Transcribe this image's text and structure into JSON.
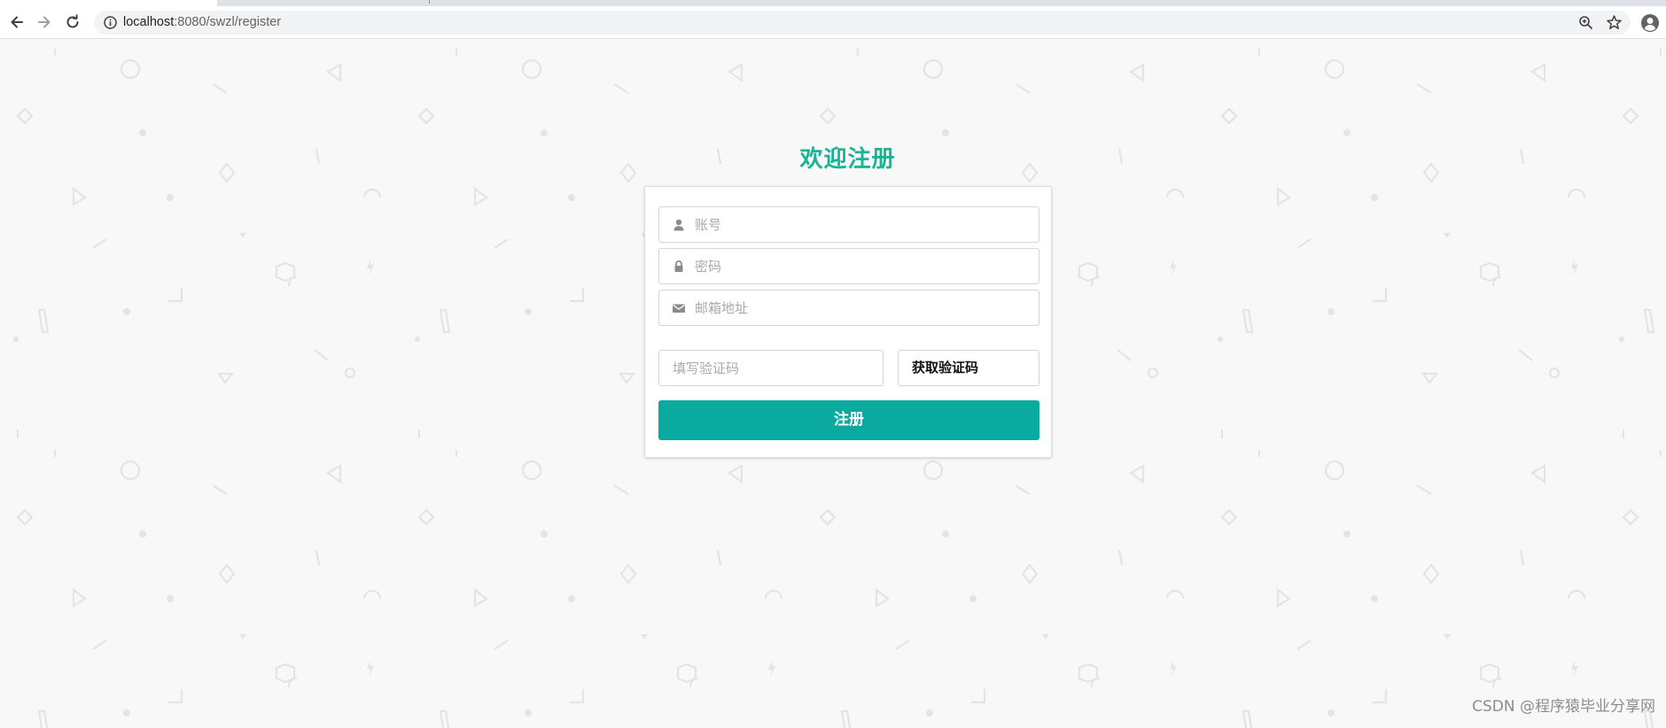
{
  "browser": {
    "url_host": "localhost",
    "url_rest": ":8080/swzl/register"
  },
  "page": {
    "title": "欢迎注册",
    "account_placeholder": "账号",
    "password_placeholder": "密码",
    "email_placeholder": "邮箱地址",
    "code_placeholder": "填写验证码",
    "get_code_label": "获取验证码",
    "submit_label": "注册",
    "accent_color": "#0aaaa0",
    "title_color": "#1ab394"
  },
  "icons": {
    "account": "user-icon",
    "password": "lock-icon",
    "email": "envelope-icon"
  },
  "watermark": "CSDN @程序猿毕业分享网"
}
